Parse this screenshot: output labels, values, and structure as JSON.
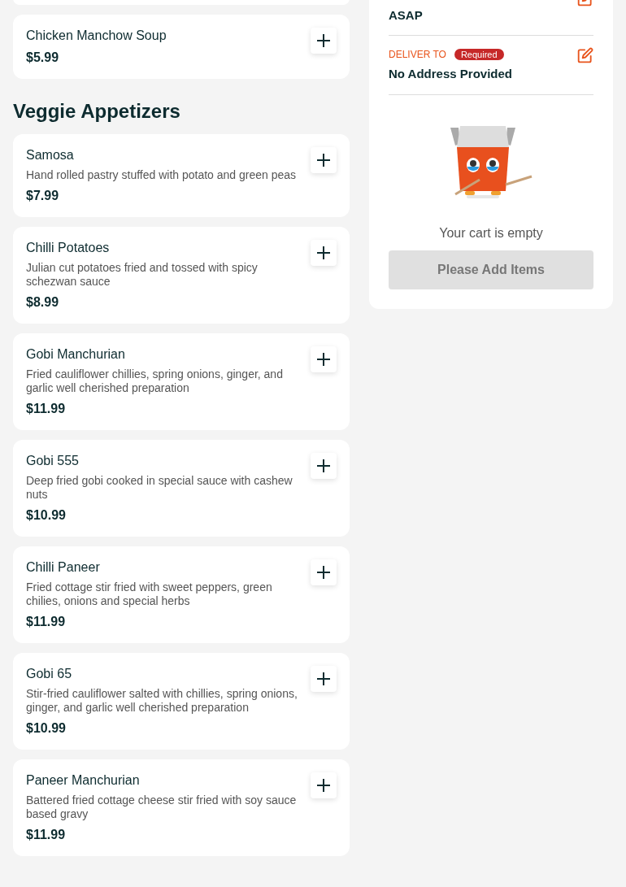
{
  "top_items": [
    {
      "name": "Chicken Manchow Soup",
      "price": "$5.99"
    }
  ],
  "sections": [
    {
      "title": "Veggie Appetizers",
      "items": [
        {
          "name": "Samosa",
          "description": "Hand rolled pastry stuffed with potato and green peas",
          "price": "$7.99"
        },
        {
          "name": "Chilli Potatoes",
          "description": "Julian cut potatoes fried and tossed with spicy schezwan sauce",
          "price": "$8.99"
        },
        {
          "name": "Gobi Manchurian",
          "description": "Fried cauliflower chillies, spring onions, ginger, and garlic well cherished preparation",
          "price": "$11.99"
        },
        {
          "name": "Gobi 555",
          "description": "Deep fried gobi cooked in special sauce with cashew nuts",
          "price": "$10.99"
        },
        {
          "name": "Chilli Paneer",
          "description": "Fried cottage stir fried with sweet peppers, green chilies, onions and special herbs",
          "price": "$11.99"
        },
        {
          "name": "Gobi 65",
          "description": "Stir-fried cauliflower salted with chillies, spring onions, ginger, and garlic well cherished preparation",
          "price": "$10.99"
        },
        {
          "name": "Paneer Manchurian",
          "description": "Battered fried cottage cheese stir fried with soy sauce based gravy",
          "price": "$11.99"
        }
      ]
    }
  ],
  "cart": {
    "delivery_time": {
      "value": "ASAP"
    },
    "deliver_to": {
      "label": "DELIVER TO",
      "badge": "Required",
      "value": "No Address Provided"
    },
    "empty_message": "Your cart is empty",
    "button": {
      "label": "Please Add Items",
      "disabled": true
    }
  }
}
